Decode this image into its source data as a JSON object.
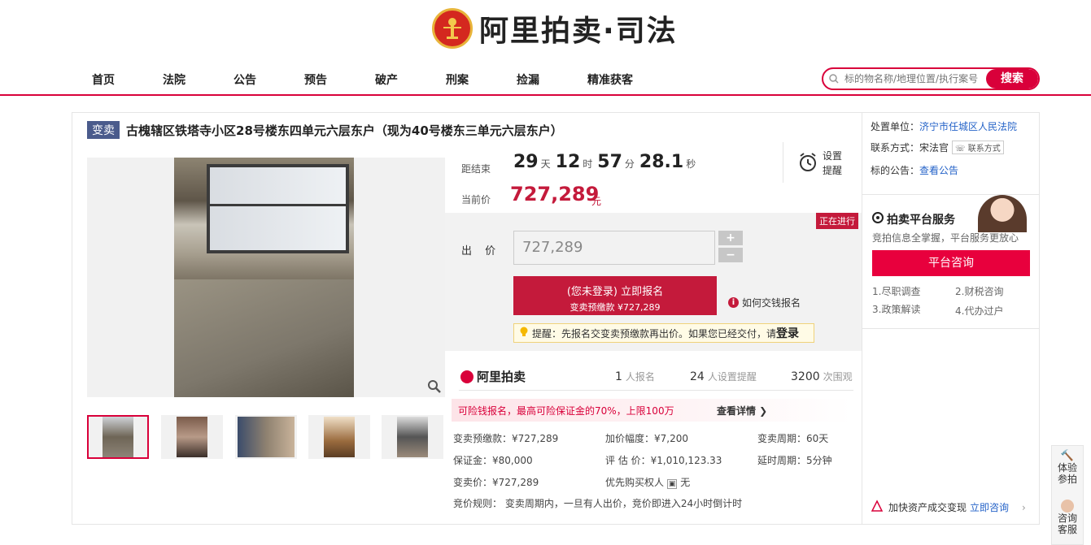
{
  "header": {
    "logo_text": "阿里拍卖·司法",
    "colors": {
      "accent": "#d9003a",
      "price": "#c41a3b",
      "link": "#2563c8"
    }
  },
  "nav": {
    "items": [
      "首页",
      "法院",
      "公告",
      "预告",
      "破产",
      "刑案",
      "捡漏",
      "精准获客"
    ],
    "search_placeholder": "标的物名称/地理位置/执行案号",
    "search_button": "搜索"
  },
  "listing": {
    "tag": "变卖",
    "title": "古槐辖区铁塔寺小区28号楼东四单元六层东户（现为40号楼东三单元六层东户）"
  },
  "countdown": {
    "label": "距结束",
    "days": "29",
    "days_unit": "天",
    "hours": "12",
    "hours_unit": "时",
    "minutes": "57",
    "minutes_unit": "分",
    "seconds": "28.1",
    "seconds_unit": "秒"
  },
  "reminder": {
    "label": "设置提醒"
  },
  "price": {
    "label": "当前价",
    "value": "727,289",
    "unit": "元"
  },
  "bid": {
    "status": "正在进行",
    "label": "出 价",
    "input_value": "727,289",
    "plus": "+",
    "minus": "−",
    "signup_line1": "(您未登录) 立即报名",
    "signup_line2": "变卖预缴款 ¥727,289",
    "howto": "如何交钱报名",
    "tip_text": "提醒：先报名交变卖预缴款再出价。如果您已经交付，请",
    "tip_login": "登录"
  },
  "stats": {
    "brand": "阿里拍卖",
    "signups": "1",
    "signups_unit": "人报名",
    "reminders": "24",
    "reminders_unit": "人设置提醒",
    "views": "3200",
    "views_unit": "次围观"
  },
  "promo": {
    "text": "可险钱报名，最高可险保证金的70%，上限100万",
    "more": "查看详情 ❯"
  },
  "details": {
    "deposit": "变卖预缴款：¥727,289",
    "increment": "加价幅度：¥7,200",
    "period": "变卖周期：60天",
    "guarantee": "保证金：¥80,000",
    "appraisal": "评 估 价：¥1,010,123.33",
    "delay": "延时周期：5分钟",
    "sale_price": "变卖价：¥727,289",
    "priority": "优先购买权人",
    "priority_value": "无",
    "rules": "竞价规则： 变卖周期内，一旦有人出价，竞价即进入24小时倒计时"
  },
  "right": {
    "court_label": "处置单位：",
    "court": "济宁市任城区人民法院",
    "contact_label": "联系方式：",
    "contact_name": "宋法官",
    "contact_button": "联系方式",
    "notice_label": "标的公告：",
    "notice_link": "查看公告",
    "service_title": "拍卖平台服务",
    "service_sub": "竞拍信息全掌握，平台服务更放心",
    "consult_button": "平台咨询",
    "services": [
      "1.尽职调查",
      "2.财税咨询",
      "3.政策解读",
      "4.代办过户"
    ],
    "bottom_text": "加快资产成交变现",
    "bottom_link": "立即咨询"
  },
  "float": {
    "item1": "体验参拍",
    "item2": "咨询客服"
  }
}
